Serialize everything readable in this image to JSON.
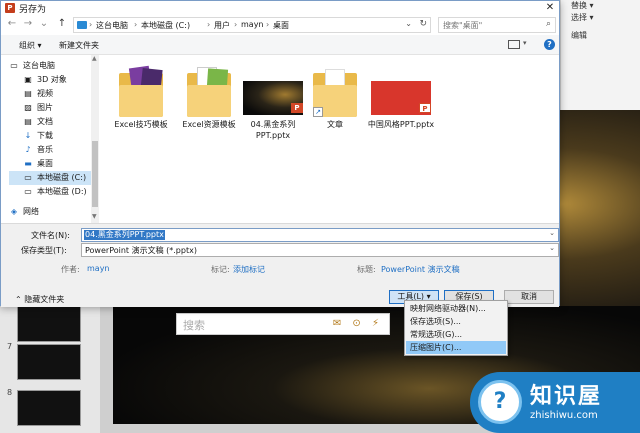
{
  "dialog": {
    "title": "另存为",
    "close_glyph": "✕"
  },
  "nav": {
    "back": "←",
    "forward": "→",
    "recent": "⌄",
    "up": "↑",
    "breadcrumbs": [
      "这台电脑",
      "本地磁盘 (C:)",
      "用户",
      "mayn",
      "桌面"
    ],
    "search_placeholder": "搜索\"桌面\""
  },
  "toolbar": {
    "organize": "组织 ▾",
    "new_folder": "新建文件夹"
  },
  "sidebar": {
    "items": [
      {
        "icon": "▭",
        "label": "这台电脑"
      },
      {
        "icon": "▣",
        "label": "3D 对象"
      },
      {
        "icon": "▤",
        "label": "视频"
      },
      {
        "icon": "▨",
        "label": "图片"
      },
      {
        "icon": "▤",
        "label": "文档"
      },
      {
        "icon": "↓",
        "label": "下载"
      },
      {
        "icon": "♪",
        "label": "音乐"
      },
      {
        "icon": "▬",
        "label": "桌面"
      },
      {
        "icon": "▭",
        "label": "本地磁盘 (C:)"
      },
      {
        "icon": "▭",
        "label": "本地磁盘 (D:)"
      },
      {
        "icon": "◈",
        "label": "网络"
      }
    ]
  },
  "files": [
    {
      "name": "Excel技巧模板",
      "kind": "folder"
    },
    {
      "name": "Excel资源模板",
      "kind": "folder"
    },
    {
      "name": "04.黑金系列PPT.pptx",
      "kind": "pptx-dark"
    },
    {
      "name": "文章",
      "kind": "folder-shortcut"
    },
    {
      "name": "中国风格PPT.pptx",
      "kind": "pptx-red"
    }
  ],
  "form": {
    "filename_label": "文件名(N):",
    "filename_value": "04.黑金系列PPT.pptx",
    "filetype_label": "保存类型(T):",
    "filetype_value": "PowerPoint 演示文稿 (*.pptx)",
    "author_label": "作者:",
    "author_value": "mayn",
    "tags_label": "标记:",
    "tags_value": "添加标记",
    "title_label": "标题:",
    "title_value": "PowerPoint 演示文稿",
    "hide_folders": "隐藏文件夹"
  },
  "buttons": {
    "tools": "工具(L)  ▾",
    "save": "保存(S)",
    "cancel": "取消"
  },
  "tools_menu": [
    "映射网络驱动器(N)...",
    "保存选项(S)...",
    "常规选项(G)...",
    "压缩图片(C)..."
  ],
  "background": {
    "ribbon": [
      "替换 ▾",
      "选择 ▾",
      "编辑"
    ],
    "slide_numbers": [
      "7",
      "8"
    ],
    "search_placeholder": "搜索",
    "search_icons": "✉ ⊙ ⚡"
  },
  "watermark": {
    "title": "知识屋",
    "url": "zhishiwu.com",
    "logo_glyph": "?"
  },
  "colors": {
    "accent": "#1f6fc4",
    "selection": "#cce4f7",
    "menu_highlight": "#91c9f7"
  }
}
